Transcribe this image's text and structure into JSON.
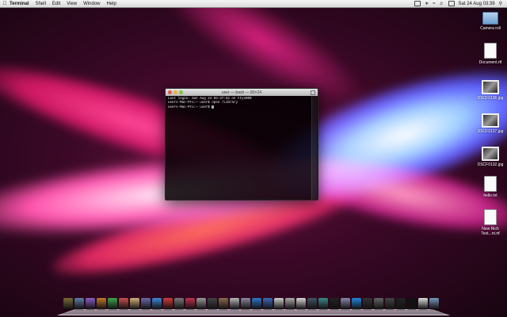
{
  "menubar": {
    "app_name": "Terminal",
    "menus": [
      "Shell",
      "Edit",
      "View",
      "Window",
      "Help"
    ],
    "clock": "Sat 24 Aug  03:39"
  },
  "desktop_icons": [
    {
      "label": "Camera roll",
      "kind": "folder"
    },
    {
      "label": "Document.rtf",
      "kind": "doc"
    },
    {
      "label": "DSCF0136.jpg",
      "kind": "photo"
    },
    {
      "label": "DSCF0137.jpg",
      "kind": "photo"
    },
    {
      "label": "DSCF0132.jpg",
      "kind": "photo"
    },
    {
      "label": "hello.txt",
      "kind": "doc"
    },
    {
      "label": "New Rich Text...nt.rtf",
      "kind": "doc"
    }
  ],
  "terminal": {
    "title": "user — bash — 80×24",
    "lines": [
      "Last login: Sat Aug 24 03:37:52 on ttys000",
      "users-Mac-Pro:~ user$ open /Library",
      "users-Mac-Pro:~ user$ "
    ]
  },
  "dock": {
    "colors": [
      "#7a6a3a",
      "#5f7fa8",
      "#8a5ec8",
      "#c07a2a",
      "#3fa64a",
      "#c95050",
      "#d2b27a",
      "#6a6aa8",
      "#3a8ad8",
      "#d13a3a",
      "#777777",
      "#c03050",
      "#999999",
      "#444444",
      "#8a6a50",
      "#b8b8b8",
      "#8a8aa0",
      "#2a78c8",
      "#3a6ab8",
      "#cfcfcf",
      "#aaaaaa",
      "#d8d8d8",
      "#445566",
      "#3a8a8a",
      "#222222",
      "#8888aa",
      "#2288dd",
      "#333333",
      "#666666",
      "#444444",
      "#222222",
      "#111111",
      "#dddddd",
      "#7799bb"
    ]
  }
}
